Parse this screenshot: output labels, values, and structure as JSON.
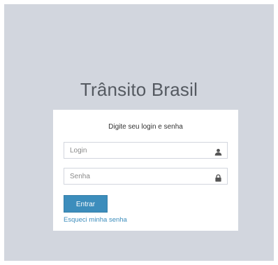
{
  "app": {
    "title": "Trânsito Brasil"
  },
  "login": {
    "message": "Digite seu login e senha",
    "login_field": {
      "placeholder": "Login",
      "value": "",
      "icon": "user-icon"
    },
    "password_field": {
      "placeholder": "Senha",
      "value": "",
      "icon": "lock-icon"
    },
    "submit_label": "Entrar",
    "forgot_link": "Esqueci minha senha"
  },
  "colors": {
    "background": "#d2d6de",
    "box": "#ffffff",
    "primary_button": "#3c8dbc",
    "link": "#3c8dbc"
  }
}
